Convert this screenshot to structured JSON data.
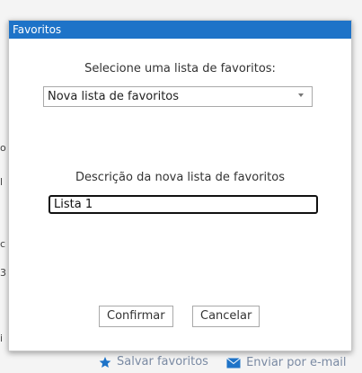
{
  "background": {
    "footer_items": [
      {
        "label": "Salvar favoritos",
        "icon": "star-icon",
        "color": "#1e73c8"
      },
      {
        "label": "Enviar por e-mail",
        "icon": "mail-icon",
        "color": "#1e73c8"
      }
    ]
  },
  "dialog": {
    "title": "Favoritos",
    "select_label": "Selecione uma lista de favoritos:",
    "selected_list": "Nova lista de favoritos",
    "description_label": "Descrição da nova lista de favoritos",
    "description_value": "Lista 1",
    "confirm_label": "Confirmar",
    "cancel_label": "Cancelar"
  },
  "colors": {
    "titlebar": "#1e73c8",
    "titlebar_text": "#ffffff"
  }
}
